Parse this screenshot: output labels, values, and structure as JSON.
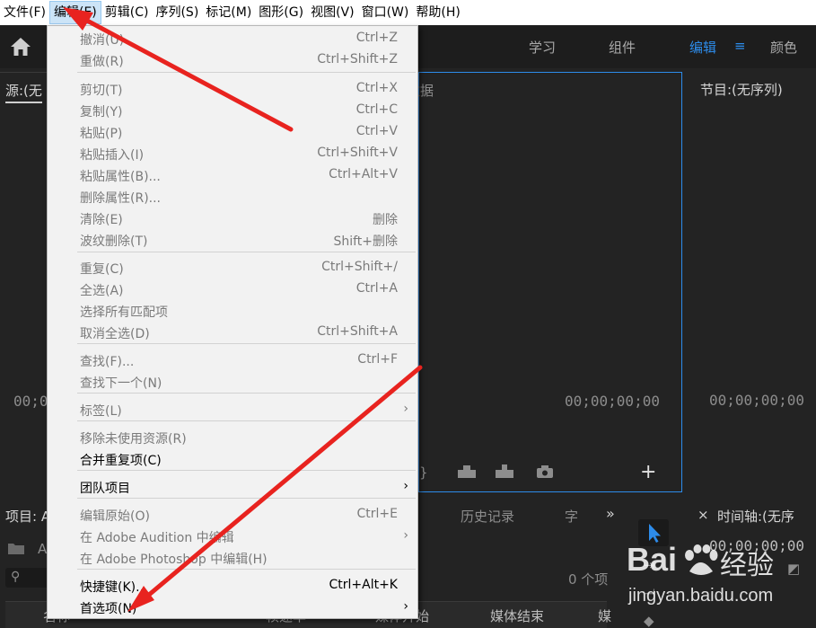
{
  "menubar": {
    "items": [
      "文件(F)",
      "编辑(E)",
      "剪辑(C)",
      "序列(S)",
      "标记(M)",
      "图形(G)",
      "视图(V)",
      "窗口(W)",
      "帮助(H)"
    ]
  },
  "header": {
    "home_icon": "home-icon",
    "tabs": [
      "学习",
      "组件",
      "编辑",
      "颜色"
    ],
    "active_tab": "编辑",
    "menu_icon": "≡"
  },
  "source_panel": {
    "title": "源:(无",
    "timecode": "00;0"
  },
  "program_left": {
    "partial_title": "数据",
    "timecode": "00;00;00;00",
    "plus": "+"
  },
  "program_panel": {
    "title": "节目:(无序列)",
    "timecode": "00;00;00;00"
  },
  "project_panel": {
    "title": "项目: A",
    "item_a": "A",
    "history_tab": "历史记录",
    "char_tab": "字",
    "more": "»",
    "count": "0 个项",
    "col_name": "名称",
    "col_fps": "帧速率",
    "col_media_start": "媒体开始",
    "col_media_end": "媒体结束",
    "col_extra": "媒"
  },
  "timeline_panel": {
    "close": "×",
    "title": "时间轴:(无序",
    "timecode": "00;00;00;00"
  },
  "edit_menu": {
    "items": [
      {
        "label": "撤消(U)",
        "shortcut": "Ctrl+Z",
        "enabled": false
      },
      {
        "label": "重做(R)",
        "shortcut": "Ctrl+Shift+Z",
        "enabled": false
      },
      {
        "label": "剪切(T)",
        "shortcut": "Ctrl+X",
        "enabled": false
      },
      {
        "label": "复制(Y)",
        "shortcut": "Ctrl+C",
        "enabled": false
      },
      {
        "label": "粘贴(P)",
        "shortcut": "Ctrl+V",
        "enabled": false
      },
      {
        "label": "粘贴插入(I)",
        "shortcut": "Ctrl+Shift+V",
        "enabled": false
      },
      {
        "label": "粘贴属性(B)...",
        "shortcut": "Ctrl+Alt+V",
        "enabled": false
      },
      {
        "label": "删除属性(R)...",
        "shortcut": "",
        "enabled": false
      },
      {
        "label": "清除(E)",
        "shortcut": "删除",
        "enabled": false
      },
      {
        "label": "波纹删除(T)",
        "shortcut": "Shift+删除",
        "enabled": false
      },
      {
        "label": "重复(C)",
        "shortcut": "Ctrl+Shift+/",
        "enabled": false
      },
      {
        "label": "全选(A)",
        "shortcut": "Ctrl+A",
        "enabled": false
      },
      {
        "label": "选择所有匹配项",
        "shortcut": "",
        "enabled": false
      },
      {
        "label": "取消全选(D)",
        "shortcut": "Ctrl+Shift+A",
        "enabled": false
      },
      {
        "label": "查找(F)...",
        "shortcut": "Ctrl+F",
        "enabled": false
      },
      {
        "label": "查找下一个(N)",
        "shortcut": "",
        "enabled": false
      },
      {
        "label": "标签(L)",
        "shortcut": "",
        "enabled": false,
        "submenu": true
      },
      {
        "label": "移除未使用资源(R)",
        "shortcut": "",
        "enabled": false
      },
      {
        "label": "合并重复项(C)",
        "shortcut": "",
        "enabled": true
      },
      {
        "label": "团队项目",
        "shortcut": "",
        "enabled": true,
        "submenu": true
      },
      {
        "label": "编辑原始(O)",
        "shortcut": "Ctrl+E",
        "enabled": false
      },
      {
        "label": "在 Adobe Audition 中编辑",
        "shortcut": "",
        "enabled": false,
        "submenu": true
      },
      {
        "label": "在 Adobe Photoshop 中编辑(H)",
        "shortcut": "",
        "enabled": false
      },
      {
        "label": "快捷键(K)...",
        "shortcut": "Ctrl+Alt+K",
        "enabled": true
      },
      {
        "label": "首选项(N)",
        "shortcut": "",
        "enabled": true,
        "submenu": true
      }
    ]
  },
  "watermark": {
    "brand": "Bai",
    "brand2": "经验",
    "url": "jingyan.baidu.com"
  },
  "colors": {
    "accent": "#2d8ceb",
    "annotation": "#e8231f"
  }
}
